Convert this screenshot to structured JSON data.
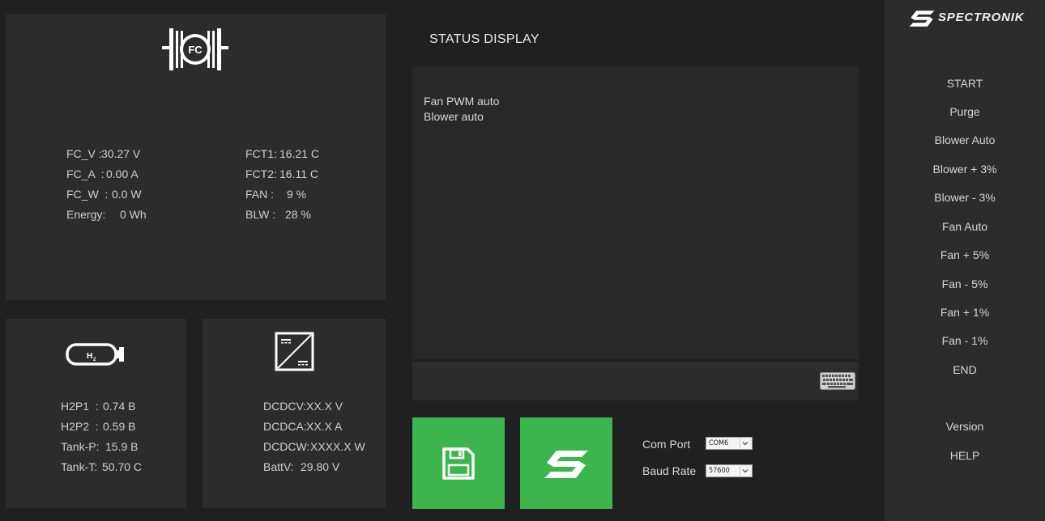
{
  "fuel_cell": {
    "icon_label": "FC",
    "readings_left": [
      {
        "label": "FC_V :",
        "value": "30.27 V"
      },
      {
        "label": "FC_A  :",
        "value": "0.00 A"
      },
      {
        "label": "FC_W  :",
        "value": "0.0 W"
      },
      {
        "label": "Energy:",
        "value": "0 Wh"
      }
    ],
    "readings_right": [
      {
        "label": "FCT1:",
        "value": "16.21 C"
      },
      {
        "label": "FCT2:",
        "value": "16.11 C"
      },
      {
        "label": "FAN :",
        "value": "9 %"
      },
      {
        "label": "BLW :",
        "value": "28 %"
      }
    ]
  },
  "hydrogen": {
    "icon_label": "H",
    "icon_sub": "2",
    "readings": [
      {
        "label": "H2P1  :",
        "value": "0.74 B"
      },
      {
        "label": "H2P2  :",
        "value": "0.59 B"
      },
      {
        "label": "Tank-P:",
        "value": "15.9 B"
      },
      {
        "label": "Tank-T:",
        "value": "50.70 C"
      }
    ]
  },
  "dcdc": {
    "readings": [
      {
        "label": "DCDCV:",
        "value": "XX.X V"
      },
      {
        "label": "DCDCA:",
        "value": "XX.X A"
      },
      {
        "label": "DCDCW:",
        "value": "XXXX.X W"
      },
      {
        "label": "BattV:",
        "value": "29.80 V"
      }
    ]
  },
  "status": {
    "title": "STATUS DISPLAY",
    "lines": [
      "Fan PWM auto",
      "Blower auto"
    ]
  },
  "connection": {
    "com_port_label": "Com Port",
    "com_port_value": "COM6",
    "baud_rate_label": "Baud Rate",
    "baud_rate_value": "57600"
  },
  "brand": {
    "name": "SPECTRONIK",
    "accent_color": "#3cb64c"
  },
  "menu": {
    "items": [
      "START",
      "Purge",
      "Blower Auto",
      "Blower + 3%",
      "Blower - 3%",
      "Fan Auto",
      "Fan + 5%",
      "Fan - 5%",
      "Fan + 1%",
      "Fan - 1%",
      "END"
    ],
    "version": "Version",
    "help": "HELP"
  },
  "icons": [
    "fuel-cell-icon",
    "hydrogen-tank-icon",
    "dcdc-converter-icon",
    "keyboard-icon",
    "save-icon",
    "spectronik-logo-icon"
  ]
}
